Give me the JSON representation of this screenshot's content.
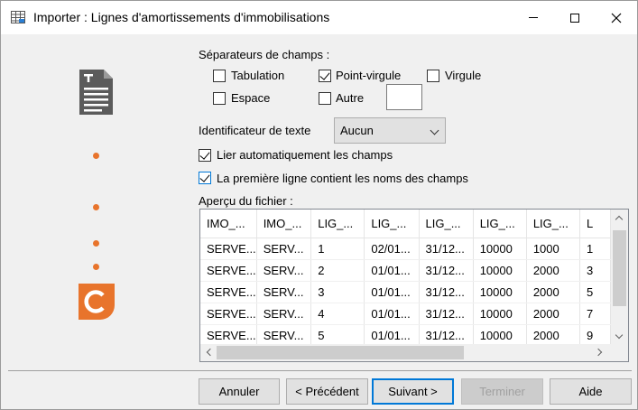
{
  "window": {
    "title": "Importer : Lignes d'amortissements d'immobilisations"
  },
  "icons": {
    "title": "table-icon",
    "document": "text-document-icon",
    "logo": "app-logo-icon"
  },
  "colors": {
    "accent": "#0078d7",
    "dot": "#e8742c",
    "logo": "#e8742c",
    "document": "#5b5b5b"
  },
  "field_separators": {
    "label": "Séparateurs de champs :",
    "tabulation": {
      "label": "Tabulation",
      "checked": false
    },
    "point_virgule": {
      "label": "Point-virgule",
      "checked": true
    },
    "virgule": {
      "label": "Virgule",
      "checked": false
    },
    "espace": {
      "label": "Espace",
      "checked": false
    },
    "autre": {
      "label": "Autre",
      "checked": false,
      "value": ""
    }
  },
  "text_identifier": {
    "label": "Identificateur de texte",
    "value": "Aucun"
  },
  "options": {
    "auto_link": {
      "label": "Lier automatiquement les champs",
      "checked": true
    },
    "first_line_names": {
      "label": "La première ligne contient les noms des champs",
      "checked": true
    }
  },
  "preview": {
    "label": "Aperçu du fichier :",
    "columns": [
      "IMO_...",
      "IMO_...",
      "LIG_...",
      "LIG_...",
      "LIG_...",
      "LIG_...",
      "LIG_...",
      "L"
    ],
    "rows": [
      [
        "SERVE...",
        "SERV...",
        "1",
        "02/01...",
        "31/12...",
        "10000",
        "1000",
        "1"
      ],
      [
        "SERVE...",
        "SERV...",
        "2",
        "01/01...",
        "31/12...",
        "10000",
        "2000",
        "3"
      ],
      [
        "SERVE...",
        "SERV...",
        "3",
        "01/01...",
        "31/12...",
        "10000",
        "2000",
        "5"
      ],
      [
        "SERVE...",
        "SERV...",
        "4",
        "01/01...",
        "31/12...",
        "10000",
        "2000",
        "7"
      ],
      [
        "SERVE...",
        "SERV...",
        "5",
        "01/01...",
        "31/12...",
        "10000",
        "2000",
        "9"
      ]
    ]
  },
  "buttons": {
    "cancel": "Annuler",
    "previous": "< Précédent",
    "next": "Suivant >",
    "finish": "Terminer",
    "help": "Aide"
  }
}
